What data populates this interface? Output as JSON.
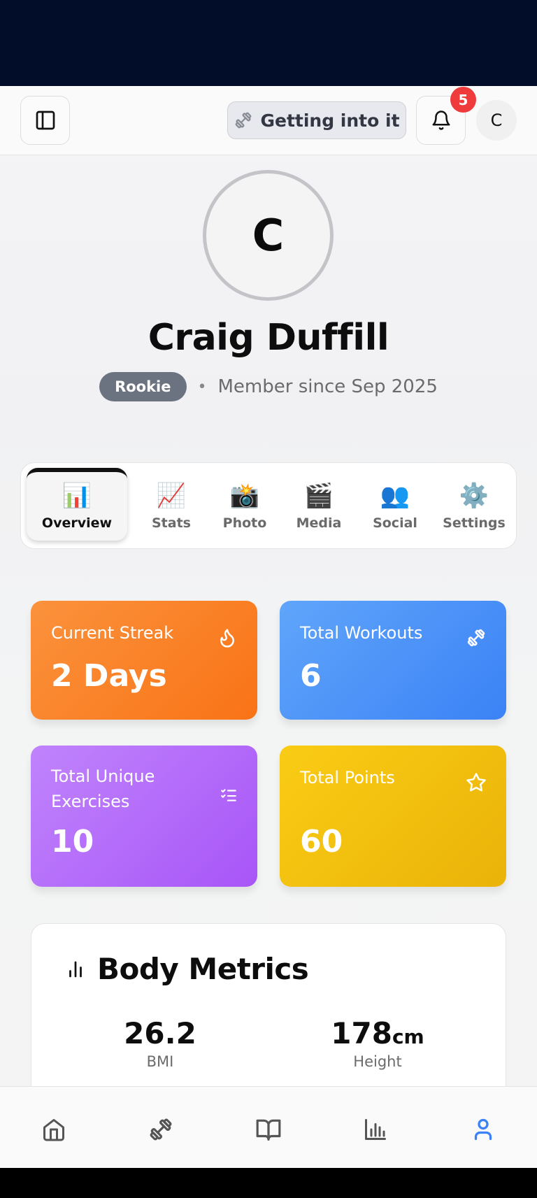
{
  "header": {
    "level_label": "Getting into it",
    "notification_count": "5",
    "avatar_initial": "C"
  },
  "profile": {
    "initial": "C",
    "name": "Craig Duffill",
    "rank": "Rookie",
    "separator": "•",
    "member_since": "Member since Sep 2025"
  },
  "tabs": [
    {
      "label": "Overview",
      "emoji": "📊",
      "active": true
    },
    {
      "label": "Stats",
      "emoji": "📈",
      "active": false
    },
    {
      "label": "Photo",
      "emoji": "📸",
      "active": false
    },
    {
      "label": "Media",
      "emoji": "🎬",
      "active": false
    },
    {
      "label": "Social",
      "emoji": "👥",
      "active": false
    },
    {
      "label": "Settings",
      "emoji": "⚙️",
      "active": false
    }
  ],
  "stats": {
    "streak": {
      "title": "Current Streak",
      "value": "2 Days",
      "icon": "flame-icon",
      "color": "#f97316"
    },
    "workouts": {
      "title": "Total Workouts",
      "value": "6",
      "icon": "dumbbell-icon",
      "color": "#3b82f6"
    },
    "unique": {
      "title": "Total Unique Exercises",
      "value": "10",
      "icon": "checklist-icon",
      "color": "#a855f7"
    },
    "points": {
      "title": "Total Points",
      "value": "60",
      "icon": "star-icon",
      "color": "#eab308"
    }
  },
  "body_metrics": {
    "title": "Body Metrics",
    "bmi": {
      "value": "26.2",
      "label": "BMI"
    },
    "height": {
      "value": "178",
      "unit": "cm",
      "label": "Height"
    }
  },
  "bottom_nav": {
    "items": [
      "home-icon",
      "dumbbell-icon",
      "book-icon",
      "chart-icon",
      "user-icon"
    ],
    "active_color": "#3b82f6",
    "inactive_color": "#555555"
  }
}
